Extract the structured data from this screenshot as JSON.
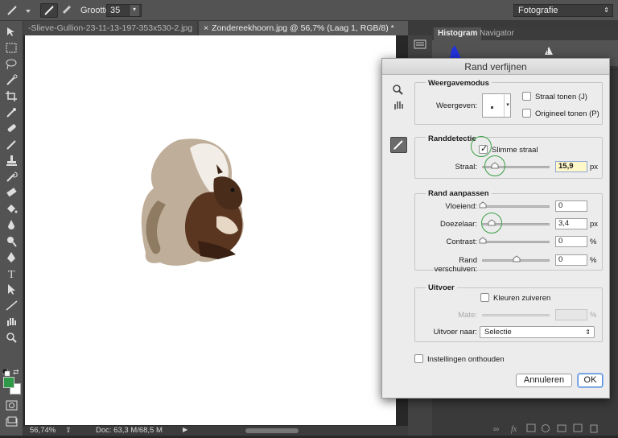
{
  "options_bar": {
    "size_label": "Grootte:",
    "size_value": "35",
    "workspace": "Fotografie"
  },
  "tabs": [
    {
      "label": "-Slieve-Gullion-23-11-13-197-353x530-2.jpg"
    },
    {
      "label": "Zondereekhoorn.jpg @ 56,7% (Laag 1, RGB/8) *"
    }
  ],
  "status": {
    "zoom": "56,74%",
    "doc_info": "Doc: 63,3 M/68,5 M"
  },
  "panels": {
    "tab_histogram": "Histogram",
    "tab_navigator": "Navigator"
  },
  "dialog": {
    "title": "Rand verfijnen",
    "view_mode": {
      "group_title": "Weergavemodus",
      "view_label": "Weergeven:",
      "show_radius": "Straal tonen (J)",
      "show_original": "Origineel tonen (P)"
    },
    "edge_detection": {
      "group_title": "Randdetectie",
      "smart_radius": "Slimme straal",
      "smart_radius_checked": true,
      "radius_label": "Straal:",
      "radius_value": "15,9",
      "radius_unit": "px",
      "radius_level": 0.19
    },
    "adjust_edge": {
      "group_title": "Rand aanpassen",
      "smooth_label": "Vloeiend:",
      "smooth_value": "0",
      "feather_label": "Doezelaar:",
      "feather_value": "3,4",
      "feather_unit": "px",
      "feather_level": 0.14,
      "contrast_label": "Contrast:",
      "contrast_value": "0",
      "contrast_unit": "%",
      "shift_label": "Rand verschuiven:",
      "shift_value": "0",
      "shift_unit": "%"
    },
    "output": {
      "group_title": "Uitvoer",
      "decontaminate": "Kleuren zuiveren",
      "amount_label": "Mate:",
      "amount_unit": "%",
      "output_to_label": "Uitvoer naar:",
      "output_to_value": "Selectie"
    },
    "remember": "Instellingen onthouden",
    "cancel": "Annuleren",
    "ok": "OK"
  },
  "colors": {
    "foreground": "#2e9a48",
    "background": "#ffffff",
    "highlight_circle": "#3aa046"
  }
}
